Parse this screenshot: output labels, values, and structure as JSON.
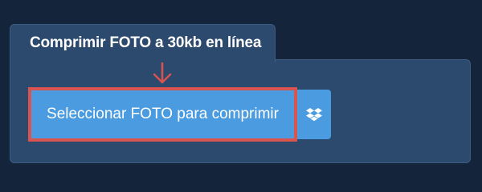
{
  "panel": {
    "title": "Comprimir FOTO a 30kb en línea"
  },
  "upload": {
    "select_label": "Seleccionar FOTO para comprimir",
    "dropbox_icon": "dropbox-icon"
  },
  "colors": {
    "background": "#14243a",
    "panel": "#2c4a6d",
    "button": "#4a9be0",
    "highlight": "#d9534f"
  }
}
